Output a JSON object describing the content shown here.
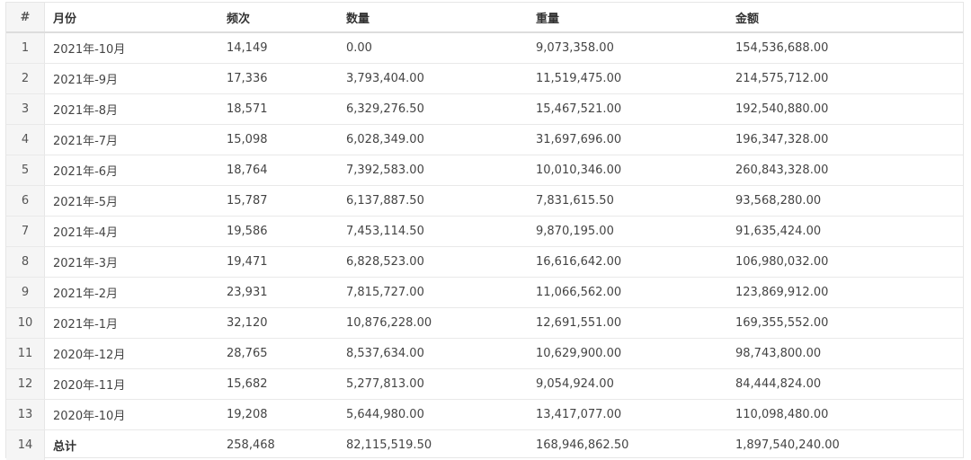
{
  "table": {
    "headers": {
      "index": "#",
      "month": "月份",
      "frequency": "频次",
      "quantity": "数量",
      "weight": "重量",
      "amount": "金额"
    },
    "rows": [
      {
        "index": "1",
        "month": "2021年-10月",
        "frequency": "14,149",
        "quantity": "0.00",
        "weight": "9,073,358.00",
        "amount": "154,536,688.00"
      },
      {
        "index": "2",
        "month": "2021年-9月",
        "frequency": "17,336",
        "quantity": "3,793,404.00",
        "weight": "11,519,475.00",
        "amount": "214,575,712.00"
      },
      {
        "index": "3",
        "month": "2021年-8月",
        "frequency": "18,571",
        "quantity": "6,329,276.50",
        "weight": "15,467,521.00",
        "amount": "192,540,880.00"
      },
      {
        "index": "4",
        "month": "2021年-7月",
        "frequency": "15,098",
        "quantity": "6,028,349.00",
        "weight": "31,697,696.00",
        "amount": "196,347,328.00"
      },
      {
        "index": "5",
        "month": "2021年-6月",
        "frequency": "18,764",
        "quantity": "7,392,583.00",
        "weight": "10,010,346.00",
        "amount": "260,843,328.00"
      },
      {
        "index": "6",
        "month": "2021年-5月",
        "frequency": "15,787",
        "quantity": "6,137,887.50",
        "weight": "7,831,615.50",
        "amount": "93,568,280.00"
      },
      {
        "index": "7",
        "month": "2021年-4月",
        "frequency": "19,586",
        "quantity": "7,453,114.50",
        "weight": "9,870,195.00",
        "amount": "91,635,424.00"
      },
      {
        "index": "8",
        "month": "2021年-3月",
        "frequency": "19,471",
        "quantity": "6,828,523.00",
        "weight": "16,616,642.00",
        "amount": "106,980,032.00"
      },
      {
        "index": "9",
        "month": "2021年-2月",
        "frequency": "23,931",
        "quantity": "7,815,727.00",
        "weight": "11,066,562.00",
        "amount": "123,869,912.00"
      },
      {
        "index": "10",
        "month": "2021年-1月",
        "frequency": "32,120",
        "quantity": "10,876,228.00",
        "weight": "12,691,551.00",
        "amount": "169,355,552.00"
      },
      {
        "index": "11",
        "month": "2020年-12月",
        "frequency": "28,765",
        "quantity": "8,537,634.00",
        "weight": "10,629,900.00",
        "amount": "98,743,800.00"
      },
      {
        "index": "12",
        "month": "2020年-11月",
        "frequency": "15,682",
        "quantity": "5,277,813.00",
        "weight": "9,054,924.00",
        "amount": "84,444,824.00"
      },
      {
        "index": "13",
        "month": "2020年-10月",
        "frequency": "19,208",
        "quantity": "5,644,980.00",
        "weight": "13,417,077.00",
        "amount": "110,098,480.00"
      },
      {
        "index": "14",
        "month": "总计",
        "frequency": "258,468",
        "quantity": "82,115,519.50",
        "weight": "168,946,862.50",
        "amount": "1,897,540,240.00",
        "is_total": true
      }
    ]
  }
}
